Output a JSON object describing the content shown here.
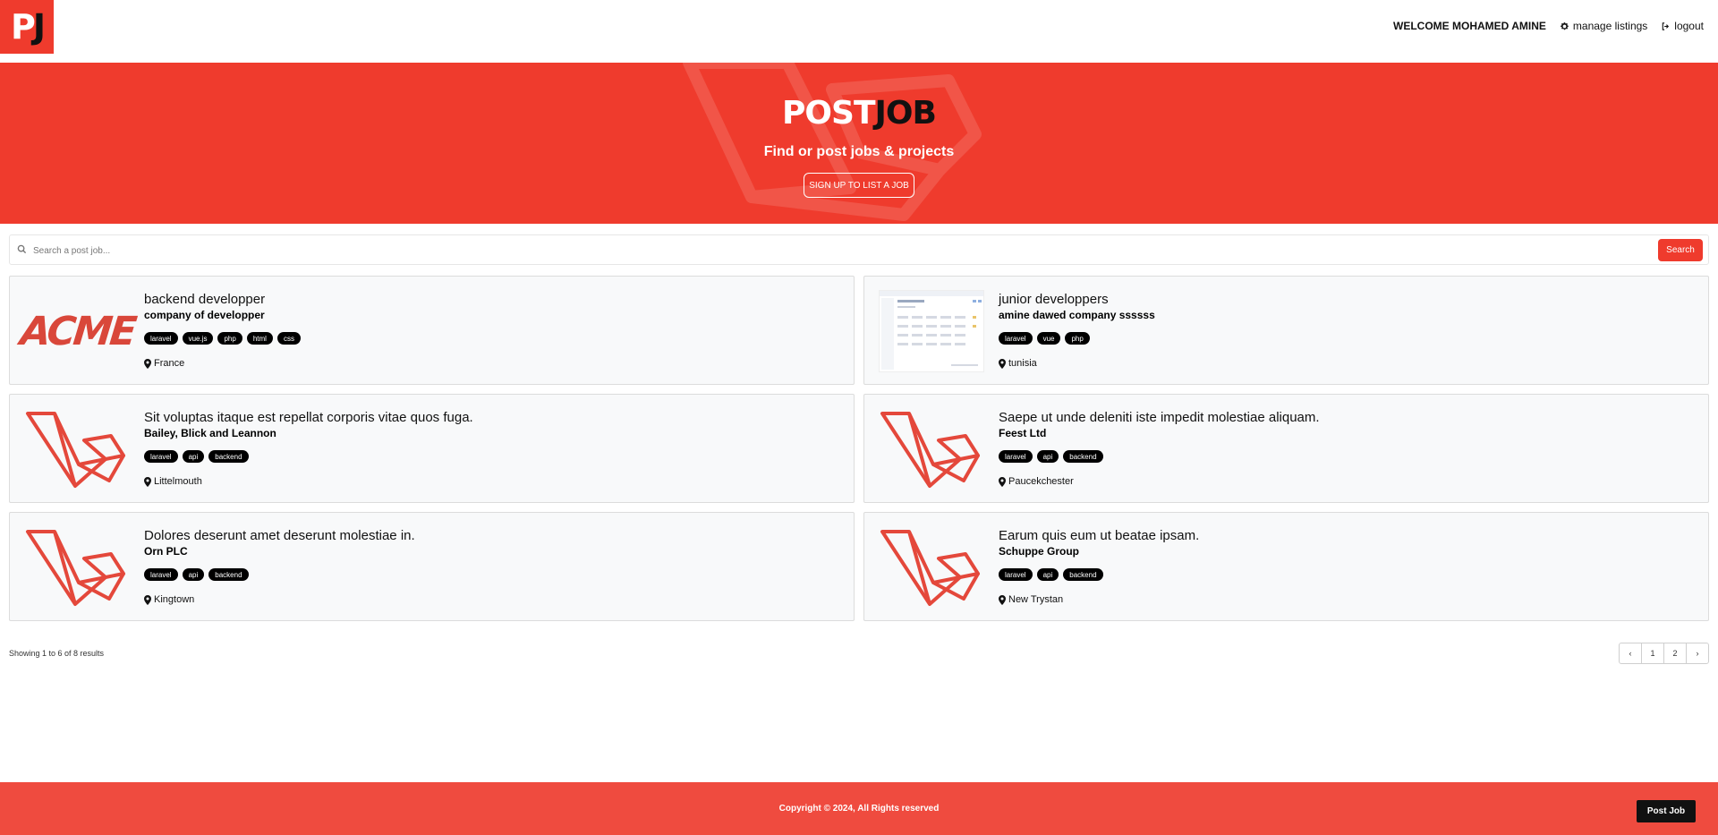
{
  "brand": {
    "logo_p": "P",
    "logo_j": "J",
    "accent": "#ef3b2d"
  },
  "nav": {
    "welcome": "WELCOME MOHAMED AMINE",
    "manage": "manage listings",
    "logout": "logout"
  },
  "hero": {
    "title_white": "POST",
    "title_black": "JOB",
    "subtitle": "Find or post jobs & projects",
    "cta": "SIGN UP TO LIST A JOB"
  },
  "search": {
    "placeholder": "Search a post job...",
    "button": "Search"
  },
  "listings": [
    {
      "title": "backend developper",
      "company": "company of developper",
      "tags": [
        "laravel",
        "vue.js",
        "php",
        "html",
        "css"
      ],
      "location": "France",
      "thumb": "ACME",
      "thumb_type": "acme"
    },
    {
      "title": "junior developpers",
      "company": "amine dawed company ssssss",
      "tags": [
        "laravel",
        "vue",
        "php"
      ],
      "location": "tunisia",
      "thumb_type": "screenshot"
    },
    {
      "title": "Sit voluptas itaque est repellat corporis vitae quos fuga.",
      "company": "Bailey, Blick and Leannon",
      "tags": [
        "laravel",
        "api",
        "backend"
      ],
      "location": "Littelmouth",
      "thumb_type": "laravel"
    },
    {
      "title": "Saepe ut unde deleniti iste impedit molestiae aliquam.",
      "company": "Feest Ltd",
      "tags": [
        "laravel",
        "api",
        "backend"
      ],
      "location": "Paucekchester",
      "thumb_type": "laravel"
    },
    {
      "title": "Dolores deserunt amet deserunt molestiae in.",
      "company": "Orn PLC",
      "tags": [
        "laravel",
        "api",
        "backend"
      ],
      "location": "Kingtown",
      "thumb_type": "laravel"
    },
    {
      "title": "Earum quis eum ut beatae ipsam.",
      "company": "Schuppe Group",
      "tags": [
        "laravel",
        "api",
        "backend"
      ],
      "location": "New Trystan",
      "thumb_type": "laravel"
    }
  ],
  "pagination": {
    "results_text": "Showing 1 to 6 of 8 results",
    "pages": [
      "1",
      "2"
    ],
    "prev": "‹",
    "next": "›"
  },
  "footer": {
    "copyright": "Copyright © 2024, All Rights reserved",
    "post_button": "Post Job"
  }
}
